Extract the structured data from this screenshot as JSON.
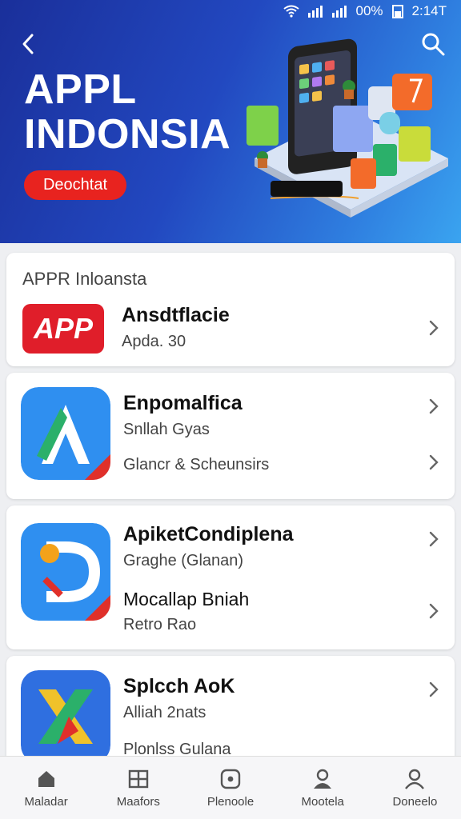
{
  "status_bar": {
    "battery": "00%",
    "time": "2:14T"
  },
  "hero": {
    "title_line1": "APPL",
    "title_line2": "INDONSIA",
    "cta_label": "Deochtat"
  },
  "section": {
    "title": "APPR Inloansta"
  },
  "apps": [
    {
      "icon_text": "APP",
      "name": "Ansdtflacie",
      "sub": "Apda. 30"
    },
    {
      "name": "Enpomalfica",
      "sub": "Snllah Gyas",
      "secondary": "Glancr & Scheunsirs"
    },
    {
      "name": "ApiketCondiplena",
      "sub": "Graghe (Glanan)",
      "name2": "Mocallap Bniah",
      "sub2": "Retro Rao"
    },
    {
      "name": "Splcch AoK",
      "sub": "Alliah 2nats",
      "secondary": "Plonlss Gulana"
    }
  ],
  "tabs": [
    {
      "label": "Maladar",
      "icon": "home-icon"
    },
    {
      "label": "Maafors",
      "icon": "grid-icon"
    },
    {
      "label": "Plenoole",
      "icon": "square-dot-icon"
    },
    {
      "label": "Mootela",
      "icon": "person-icon"
    },
    {
      "label": "Doneelo",
      "icon": "user-icon"
    }
  ]
}
